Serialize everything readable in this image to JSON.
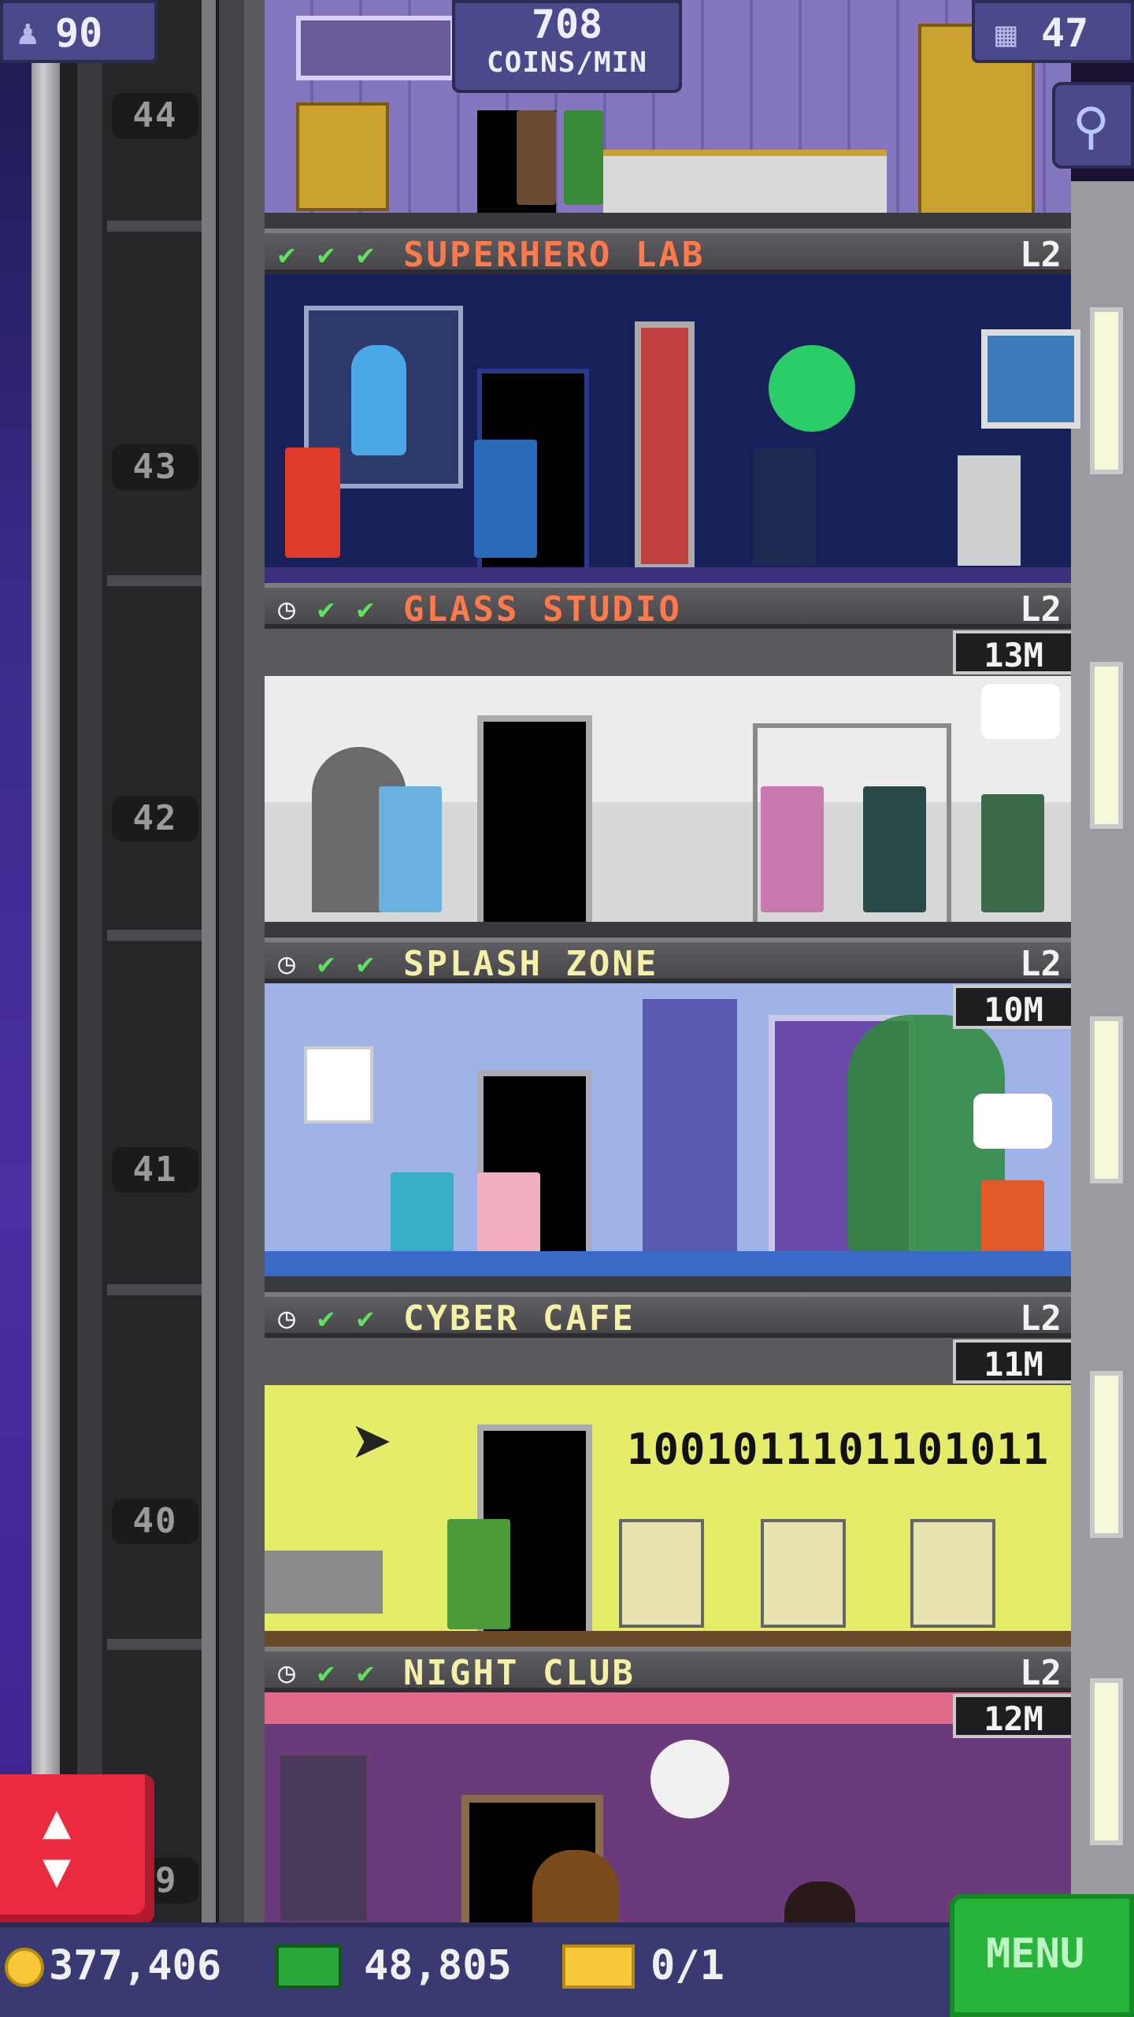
{
  "hud": {
    "population": "90",
    "coins_rate": "708",
    "coins_rate_unit": "COINS/MIN",
    "floor_count": "47"
  },
  "floor_markers": [
    "44",
    "43",
    "42",
    "41",
    "40",
    "39"
  ],
  "rooms": [
    {
      "name": "SUPERHERO LAB",
      "level": "L2",
      "status_icons": [
        "check-icon",
        "check-icon",
        "check-icon"
      ],
      "name_color": "#ff7a4a"
    },
    {
      "name": "GLASS STUDIO",
      "level": "L2",
      "timer": "13M",
      "status_icons": [
        "clock-icon",
        "check-icon",
        "check-icon"
      ],
      "name_color": "#ff7a4a"
    },
    {
      "name": "SPLASH ZONE",
      "level": "L2",
      "timer": "10M",
      "status_icons": [
        "clock-icon",
        "check-icon",
        "check-icon"
      ],
      "name_color": "#f4f0a8"
    },
    {
      "name": "CYBER CAFE",
      "level": "L2",
      "timer": "11M",
      "status_icons": [
        "clock-icon",
        "check-icon",
        "check-icon"
      ],
      "name_color": "#f4f0a8"
    },
    {
      "name": "NIGHT CLUB",
      "level": "L2",
      "timer": "12M",
      "status_icons": [
        "clock-icon",
        "check-icon",
        "check-icon"
      ],
      "name_color": "#f4f0a8"
    }
  ],
  "cyber_cafe_binary": "1001011101101011",
  "bottom": {
    "coins": "377,406",
    "bux": "48,805",
    "tickets": "0/1",
    "menu_label": "MENU"
  },
  "colors": {
    "check": "#5fe05f",
    "menu_green": "#28b43a",
    "elevator_red": "#ea2a3e"
  }
}
